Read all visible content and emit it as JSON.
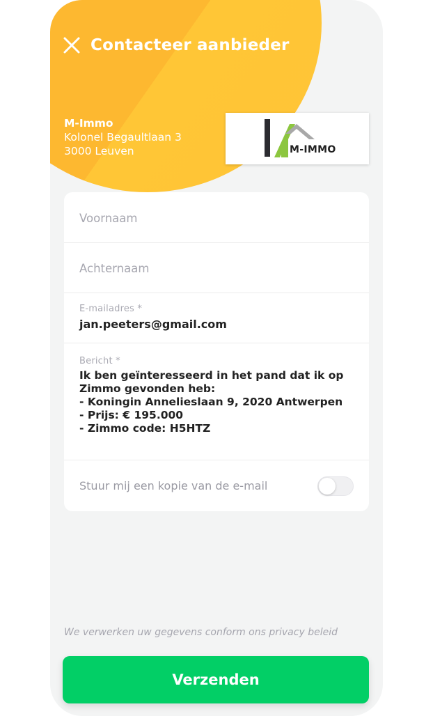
{
  "header": {
    "title": "Contacteer aanbieder",
    "close_icon": "close-icon"
  },
  "agency": {
    "name": "M-Immo",
    "street": "Kolonel Begaultlaan 3",
    "city": "3000 Leuven",
    "logo_text": "M-IMMO"
  },
  "form": {
    "first_name_placeholder": "Voornaam",
    "last_name_placeholder": "Achternaam",
    "email_label": "E-mailadres *",
    "email_value": "jan.peeters@gmail.com",
    "message_label": "Bericht *",
    "message_lines": [
      "Ik ben geïnteresseerd in het pand dat ik op",
      "Zimmo gevonden heb:",
      "- Koningin Annelieslaan 9, 2020 Antwerpen",
      "- Prijs: € 195.000",
      "- Zimmo code: H5HTZ"
    ],
    "copy_label": "Stuur mij een kopie van de e-mail",
    "copy_enabled": false
  },
  "footer": {
    "privacy_text": "We verwerken uw gegevens conform ons privacy beleid",
    "send_label": "Verzenden"
  },
  "colors": {
    "accent_yellow": "#fdb830",
    "send_green": "#02cf66"
  }
}
